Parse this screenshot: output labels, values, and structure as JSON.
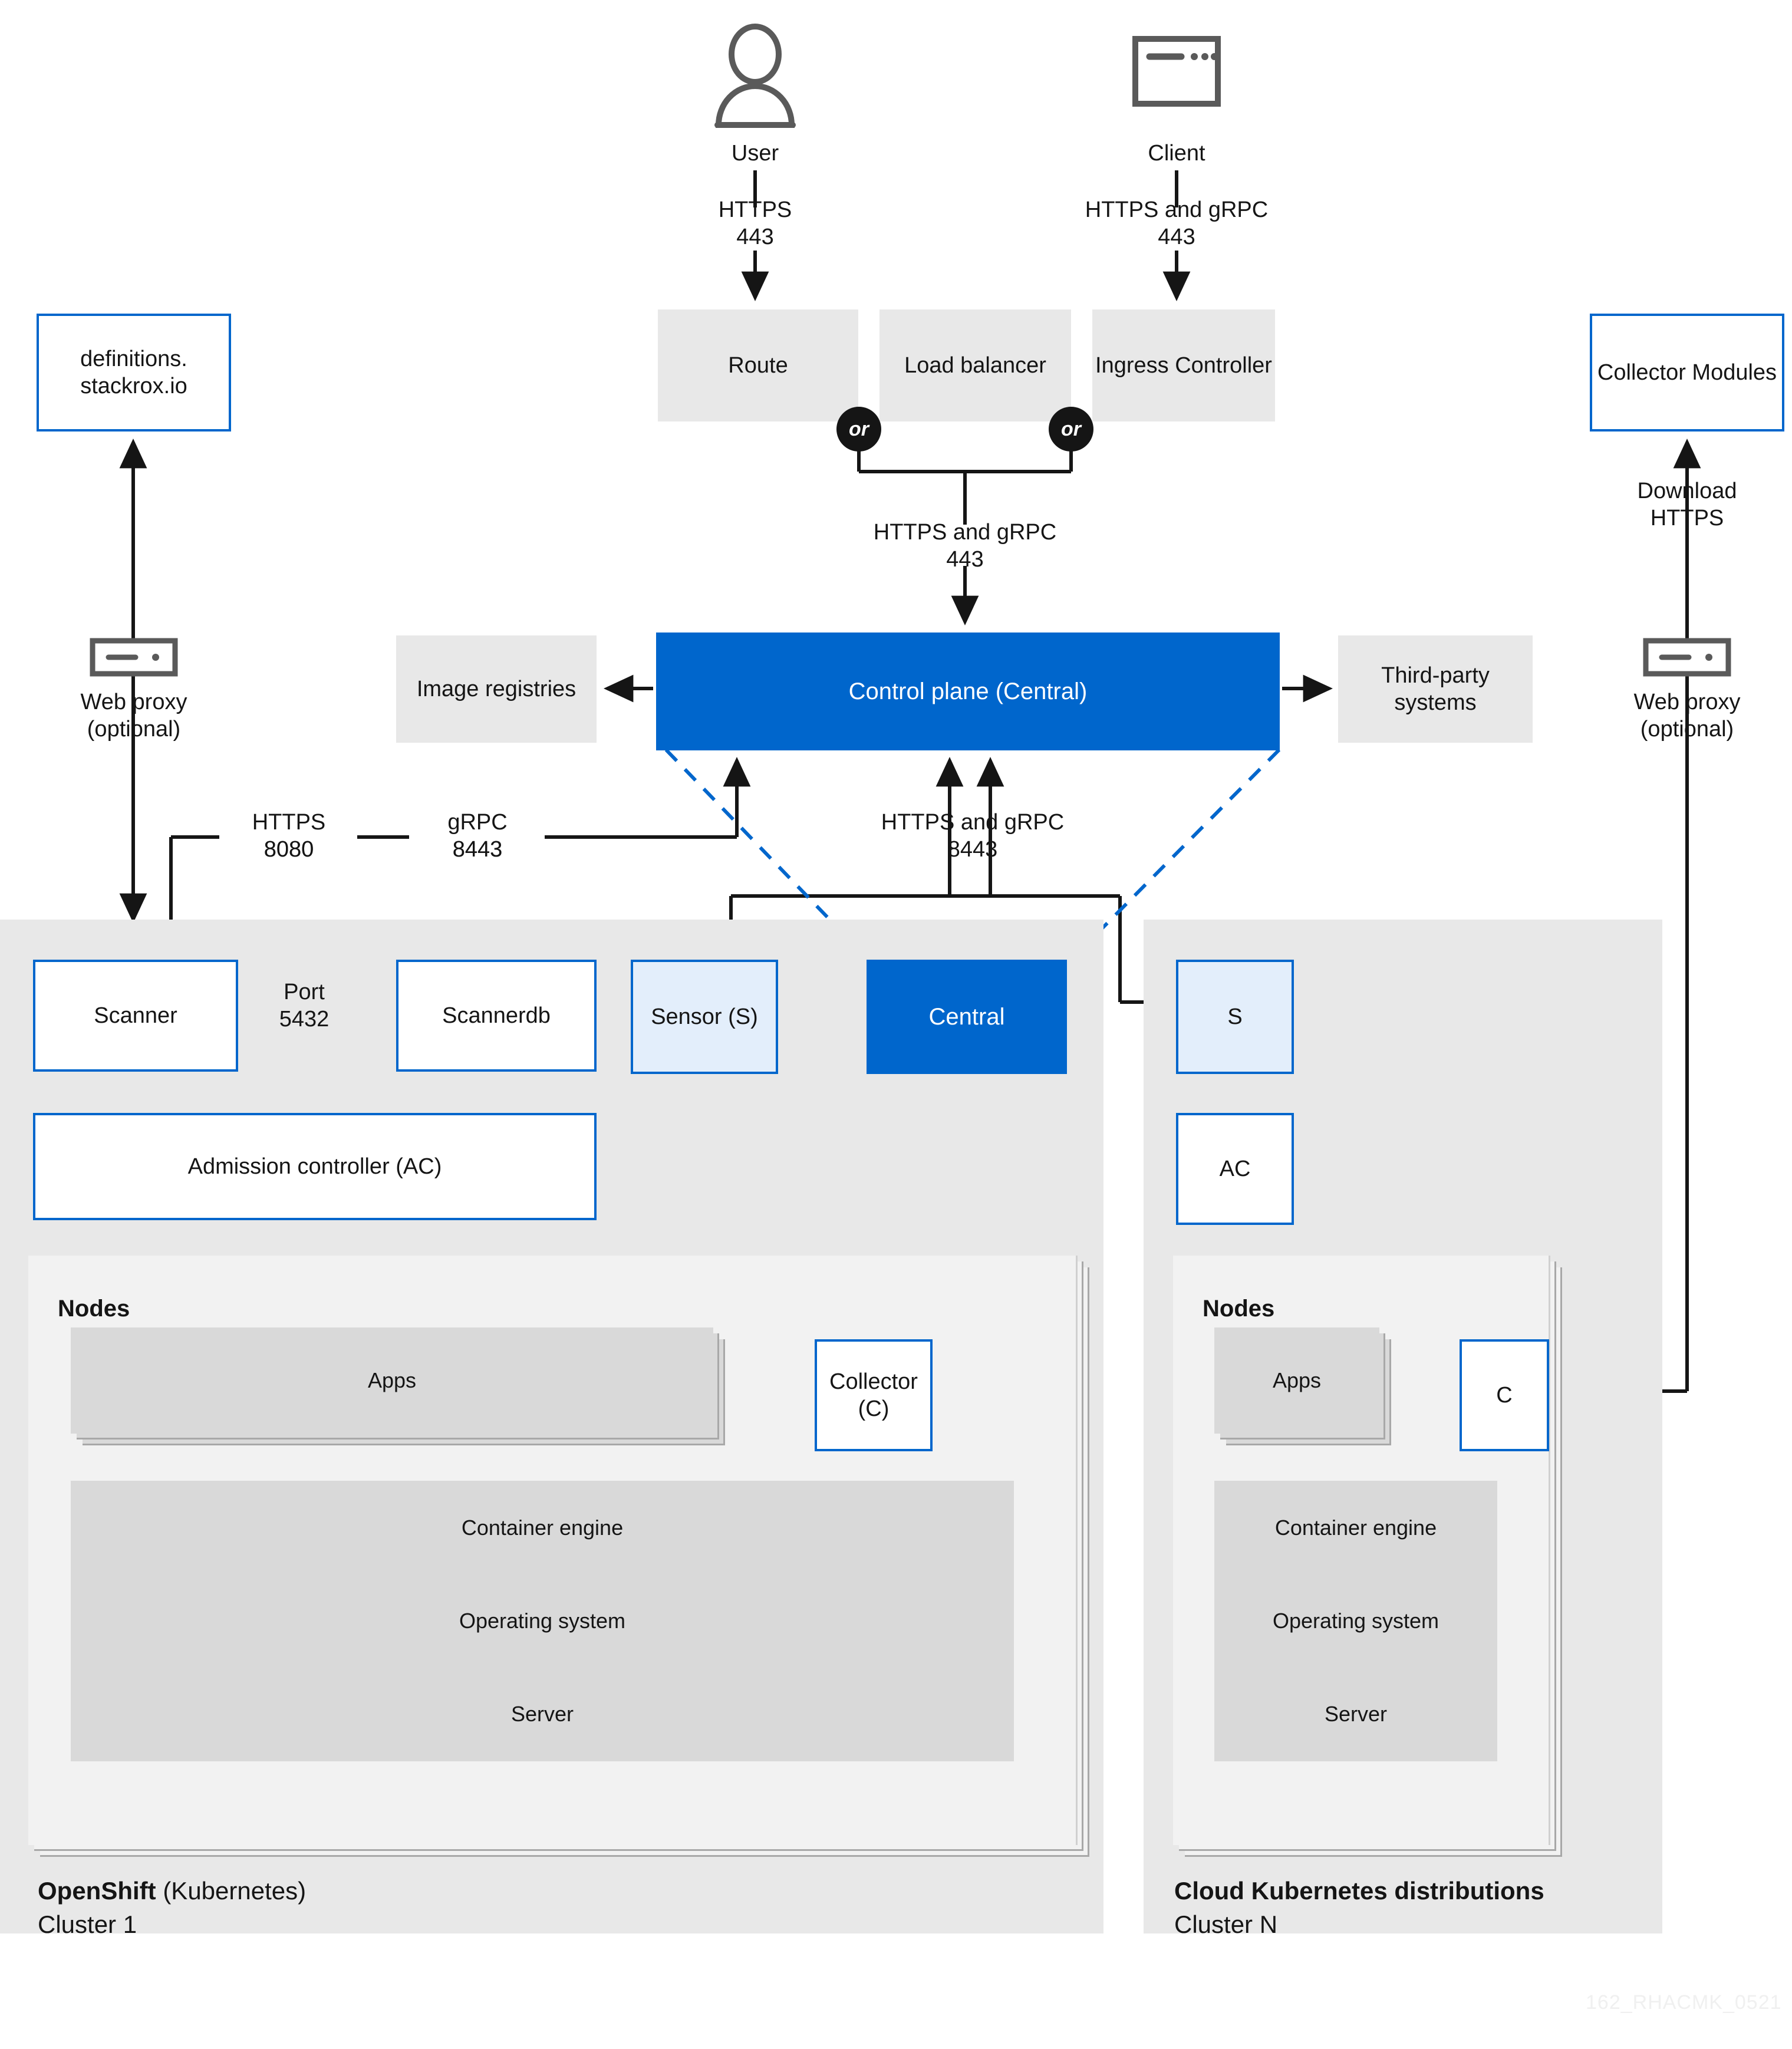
{
  "actors": {
    "user": {
      "label": "User",
      "icon": "user-icon",
      "flow": "HTTPS\n443"
    },
    "client": {
      "label": "Client",
      "icon": "window-icon",
      "flow": "HTTPS and gRPC\n443"
    }
  },
  "ingress": {
    "route": "Route",
    "load_balancer": "Load\nbalancer",
    "ingress_controller": "Ingress\nController",
    "or_left": "or",
    "or_right": "or",
    "flow_to_control_plane": "HTTPS and gRPC\n443"
  },
  "external": {
    "definitions_host": "definitions.\nstackrox.io",
    "web_proxy_left": "Web proxy\n(optional)",
    "web_proxy_right": "Web proxy\n(optional)",
    "collector_modules": "Collector\nModules",
    "download_flow": "Download\nHTTPS",
    "image_registries": "Image\nregistries",
    "third_party_systems": "Third-party\nsystems"
  },
  "control_plane": {
    "label": "Control plane\n(Central)"
  },
  "flows": {
    "scanner_https": "HTTPS\n8080",
    "scanner_grpc": "gRPC\n8443",
    "sensor_central": "HTTPS and gRPC\n8443",
    "scanner_db_port": "Port\n5432"
  },
  "cluster_openshift": {
    "title_bold": "OpenShift",
    "title_rest": " (Kubernetes)",
    "subtitle": "Cluster 1",
    "components": {
      "scanner": "Scanner",
      "scannerdb": "Scannerdb",
      "sensor": "Sensor\n(S)",
      "central": "Central",
      "admission_controller": "Admission controller\n(AC)",
      "collector": "Collector\n(C)"
    },
    "nodes": {
      "title": "Nodes",
      "layers": [
        "Apps",
        "Container engine",
        "Operating system",
        "Server"
      ]
    }
  },
  "cluster_cloud": {
    "title_bold": "Cloud Kubernetes distributions",
    "title_rest": "",
    "subtitle": "Cluster N",
    "components": {
      "sensor": "S",
      "admission_controller": "AC",
      "collector": "C"
    },
    "nodes": {
      "title": "Nodes",
      "layers": [
        "Apps",
        "Container engine",
        "Operating system",
        "Server"
      ]
    }
  },
  "watermark": "162_RHACMK_0521",
  "colors": {
    "brand_blue": "#0066cc",
    "light_blue": "#e3eefb",
    "panel_gray": "#e8e8e8",
    "nodes_gray": "#f2f2f2",
    "layer_gray": "#d9d9d9",
    "line_black": "#151515",
    "icon_gray": "#5a5a5a"
  }
}
